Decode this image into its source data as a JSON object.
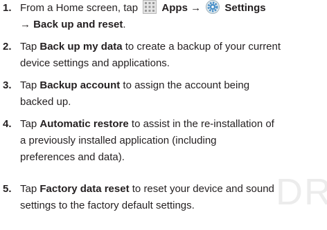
{
  "watermark": "DR",
  "icons": {
    "apps": "apps-grid-icon",
    "settings": "settings-gear-icon"
  },
  "steps": [
    {
      "num": "1.",
      "pre": "From a Home screen, tap",
      "apps": "Apps",
      "arrow1": "→",
      "settings": "Settings",
      "line2": "→ Back up and reset",
      "end": "."
    },
    {
      "num": "2.",
      "a": "Tap ",
      "bold": "Back up my data",
      "b": " to create a backup of your current",
      "line2": "device settings and applications."
    },
    {
      "num": "3.",
      "a": "Tap ",
      "bold": "Backup account",
      "b": " to assign the account being",
      "line2": "backed up."
    },
    {
      "num": "4.",
      "a": "Tap ",
      "bold": "Automatic restore",
      "b": " to assist in the re-installation of",
      "line2": "a previously installed application (including",
      "line3": "preferences and data)."
    },
    {
      "num": "5.",
      "a": "Tap ",
      "bold": "Factory data reset",
      "b": " to reset your device and sound",
      "line2": "settings to the factory default settings."
    }
  ]
}
